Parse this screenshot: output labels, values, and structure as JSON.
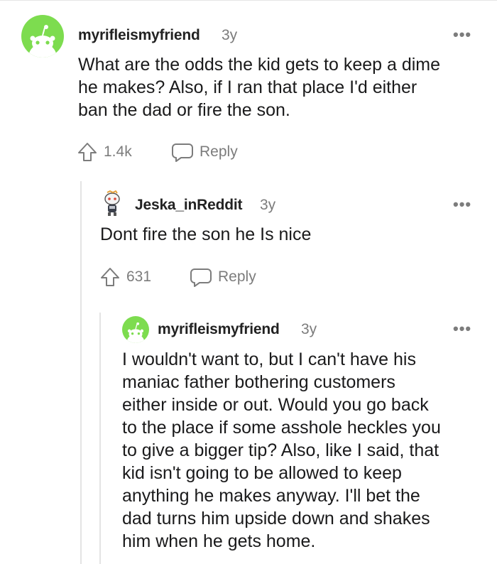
{
  "comments": [
    {
      "username": "myrifleismyfriend",
      "age": "3y",
      "more": "•••",
      "text": "What are the odds the kid gets to keep a dime\nhe makes? Also, if I ran that place I'd either\nban the dad or fire the son.",
      "votes": "1.4k",
      "reply_label": "Reply",
      "avatar_icon": "reddit-snoo-green-avatar"
    },
    {
      "username": "Jeska_inReddit",
      "age": "3y",
      "more": "•••",
      "text": "Dont fire the son he Is nice",
      "votes": "631",
      "reply_label": "Reply",
      "avatar_icon": "reddit-snoo-custom-avatar"
    },
    {
      "username": "myrifleismyfriend",
      "age": "3y",
      "more": "•••",
      "text": "I wouldn't want to, but I can't have his\nmaniac father bothering customers\neither inside or out. Would you go back\nto the place if some asshole heckles you\nto give a bigger tip? Also, like I said, that\nkid isn't going to be allowed to keep\nanything he makes anyway. I'll bet the\ndad turns him upside down and shakes\nhim when he gets home.",
      "avatar_icon": "reddit-snoo-green-avatar"
    }
  ],
  "colors": {
    "avatar_green": "#7ddc4f",
    "meta_gray": "#7c7c7c",
    "thread_line": "#e4e4e4"
  }
}
